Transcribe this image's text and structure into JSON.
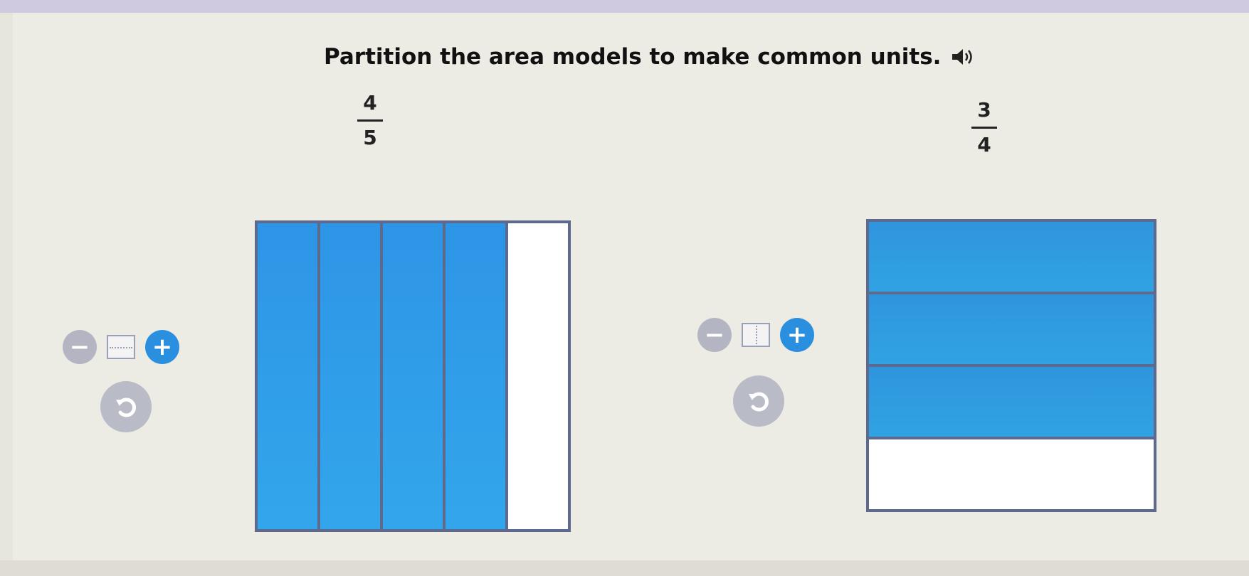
{
  "instruction": {
    "text": "Partition the area models to make common units.",
    "icon": "speaker-icon"
  },
  "models": [
    {
      "fraction": {
        "numerator": "4",
        "denominator": "5"
      },
      "orientation": "vertical",
      "parts": 5,
      "shaded": 4,
      "controls": {
        "minus": "−",
        "plus": "+"
      }
    },
    {
      "fraction": {
        "numerator": "3",
        "denominator": "4"
      },
      "orientation": "horizontal",
      "parts": 4,
      "shaded": 3,
      "controls": {
        "minus": "−",
        "plus": "+"
      }
    }
  ],
  "colors": {
    "shaded": "#2f9be6",
    "border": "#5d6a8e",
    "plus": "#2b8fe0",
    "minus": "#b3b5c3",
    "reset": "#b9bbc7"
  }
}
